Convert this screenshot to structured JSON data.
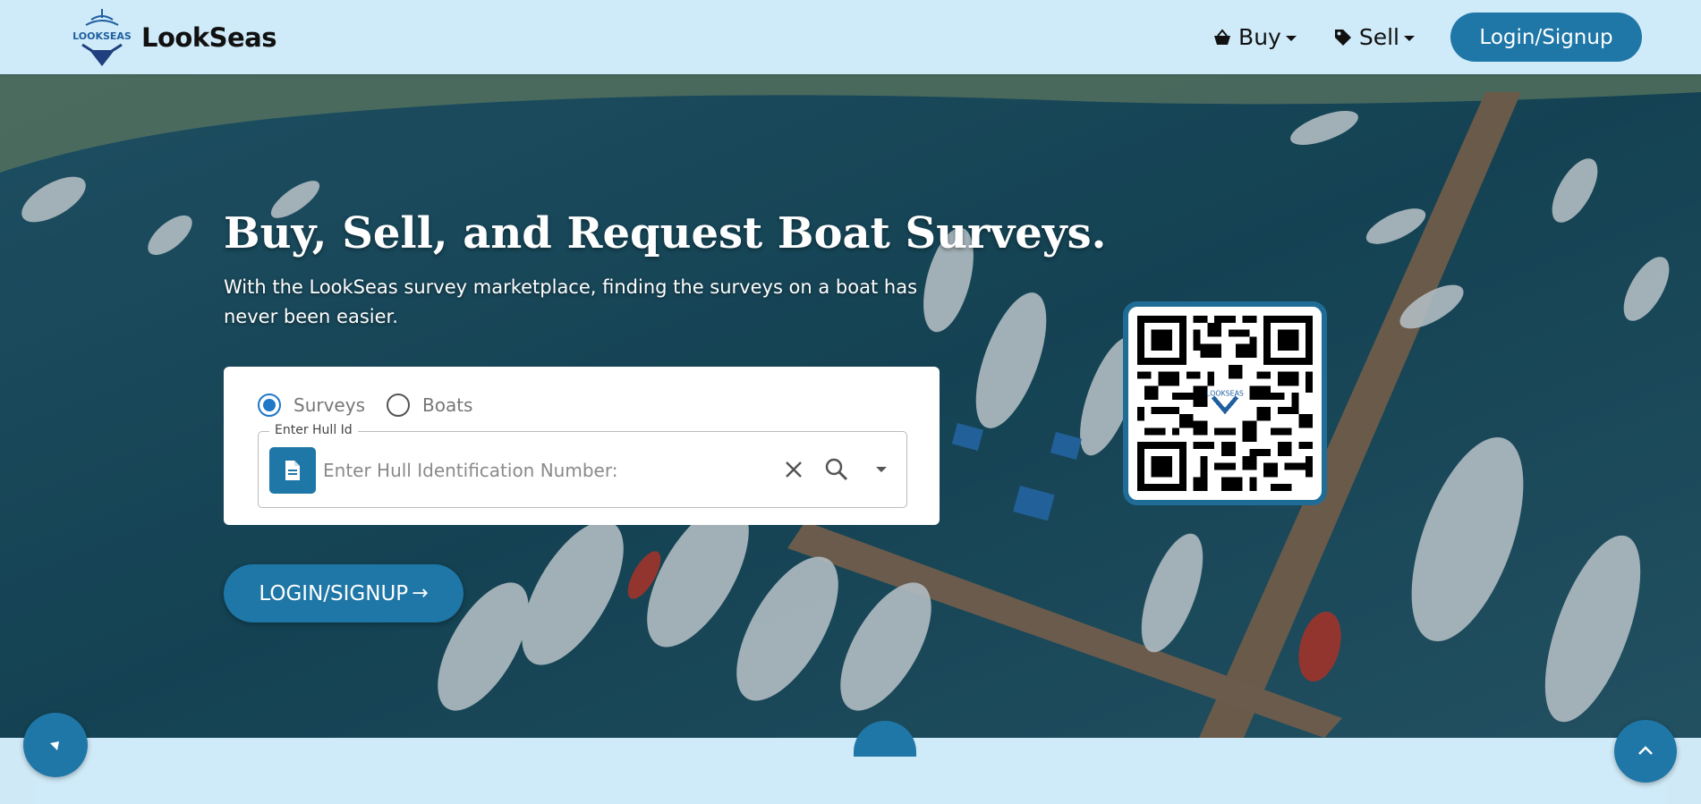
{
  "brand": {
    "name": "LookSeas",
    "logo_text": "LOOKSEAS"
  },
  "nav": {
    "buy_label": "Buy",
    "sell_label": "Sell",
    "login_label": "Login/Signup",
    "buy_icon": "basket-icon",
    "sell_icon": "tag-icon"
  },
  "hero": {
    "title": "Buy, Sell, and Request Boat Surveys.",
    "subtitle": "With the LookSeas survey marketplace, finding the surveys on a boat has never been easier."
  },
  "search": {
    "options": [
      {
        "label": "Surveys",
        "selected": true
      },
      {
        "label": "Boats",
        "selected": false
      }
    ],
    "field_legend": "Enter Hull Id",
    "placeholder": "Enter Hull Identification Number:",
    "value": ""
  },
  "cta": {
    "label": "LOGIN/SIGNUP",
    "arrow": "→"
  },
  "qr": {
    "center_logo_text": "LOOKSEAS"
  },
  "colors": {
    "accent": "#1f77a7",
    "header_bg": "#cfeaf8",
    "radio_selected": "#1f77c7"
  }
}
